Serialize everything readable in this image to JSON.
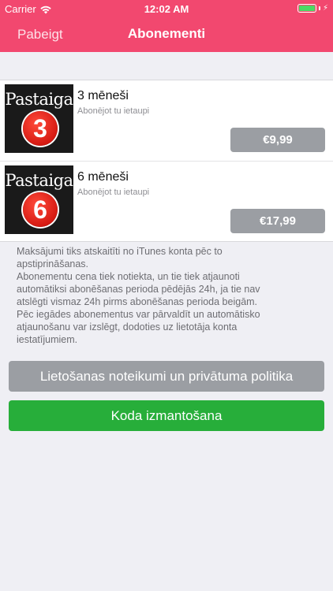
{
  "status_bar": {
    "carrier": "Carrier",
    "time": "12:02 AM",
    "battery_color": "#4cd964"
  },
  "nav": {
    "left_button": "Pabeigt",
    "title": "Abonementi",
    "background": "#f2486f"
  },
  "subscriptions": [
    {
      "cover_brand": "Pastaiga",
      "cover_number": "3",
      "title": "3 mēneši",
      "description": "Abonējot tu ietaupi",
      "price": "€9,99"
    },
    {
      "cover_brand": "Pastaiga",
      "cover_number": "6",
      "title": "6 mēneši",
      "description": "Abonējot tu ietaupi",
      "price": "€17,99"
    }
  ],
  "info_text": "Maksājumi tiks atskaitīti no iTunes konta pēc to\napstiprināšanas.\nAbonementu cena tiek notiekta, un tie tiek atjaunoti\nautomātiksi abonēšanas perioda pēdējās 24h, ja tie nav\natslēgti vismaz 24h pirms abonēšanas perioda beigām.\nPēc iegādes abonementus var pārvaldīt un automātisko\natjaunošanu var izslēgt, dodoties uz lietotāja konta\niestatījumiem.",
  "buttons": {
    "terms": "Lietošanas noteikumi un privātuma politika",
    "code": "Koda izmantošana"
  },
  "colors": {
    "accent": "#f2486f",
    "price_button": "#9b9ea3",
    "code_button": "#27ae3a"
  }
}
